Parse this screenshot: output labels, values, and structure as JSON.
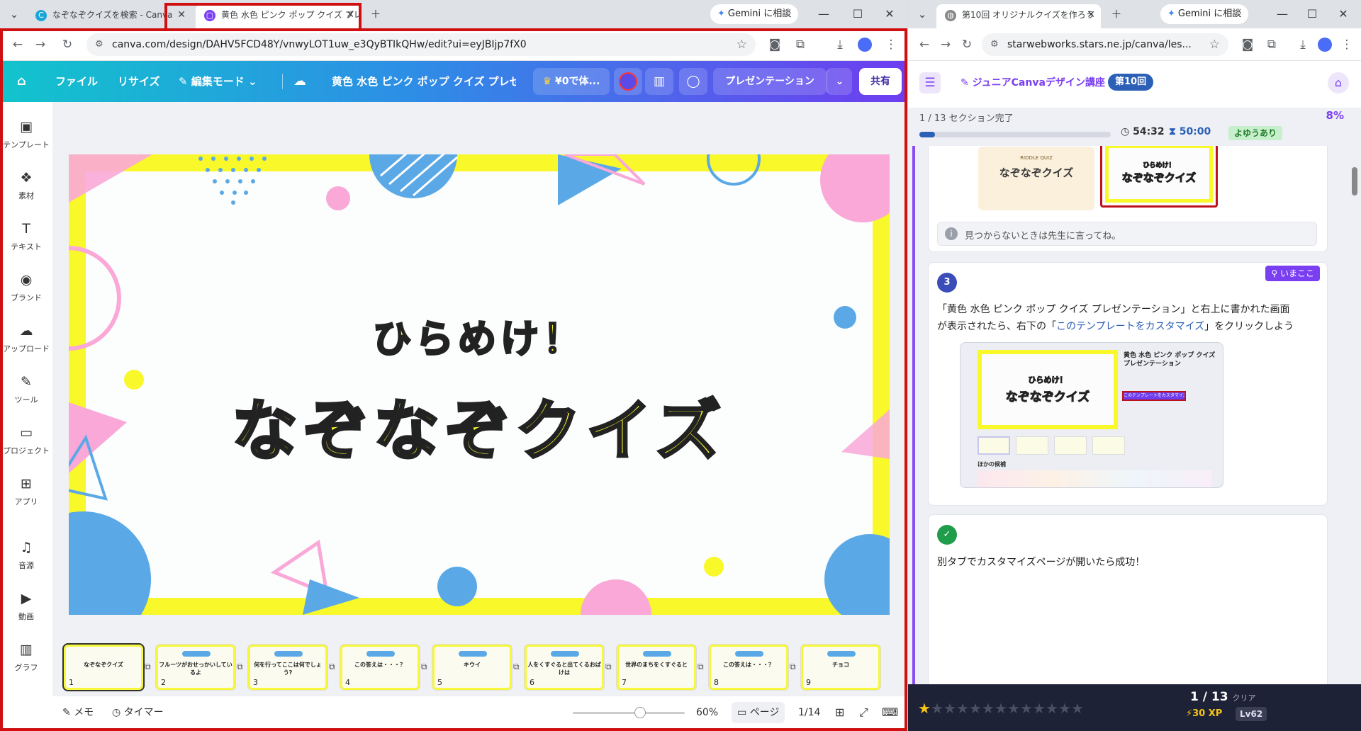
{
  "left_window": {
    "tabs": [
      {
        "title": "なぞなぞクイズを検索 - Canva",
        "active": false
      },
      {
        "title": "黄色 水色 ピンク ポップ クイズ プレ",
        "active": true
      }
    ],
    "gemini_label": "Gemini に相談",
    "url": "canva.com/design/DAHV5FCD48Y/vnwyLOT1uw_e3QyBTIkQHw/edit?ui=eyJBIjp7fX0"
  },
  "canva": {
    "toolbar": {
      "file": "ファイル",
      "resize": "リサイズ",
      "edit_mode": "編集モード",
      "title": "黄色 水色 ピンク ポップ クイズ プレゼ...",
      "trial": "¥0で体...",
      "present": "プレゼンテーション",
      "share": "共有"
    },
    "sidebar": [
      {
        "label": "テンプレート",
        "icon": "template-icon"
      },
      {
        "label": "素材",
        "icon": "elements-icon"
      },
      {
        "label": "テキスト",
        "icon": "text-icon"
      },
      {
        "label": "ブランド",
        "icon": "brand-icon"
      },
      {
        "label": "アップロード",
        "icon": "upload-icon"
      },
      {
        "label": "ツール",
        "icon": "tools-icon"
      },
      {
        "label": "プロジェクト",
        "icon": "folder-icon"
      },
      {
        "label": "アプリ",
        "icon": "apps-icon"
      },
      {
        "label": "音源",
        "icon": "music-icon"
      },
      {
        "label": "動画",
        "icon": "video-icon"
      },
      {
        "label": "グラフ",
        "icon": "chart-icon"
      }
    ],
    "slide": {
      "subtitle": "ひらめけ！",
      "title": "なぞなぞクイズ",
      "colors": {
        "yellow": "#f8f82b",
        "pink": "#f9a8d8",
        "blue": "#5aa9e6"
      }
    },
    "thumbnails": [
      {
        "num": "1",
        "text": "なぞなぞクイズ"
      },
      {
        "num": "2",
        "text": "フルーツがおせっかいしているよ"
      },
      {
        "num": "3",
        "text": "何を行ってここは何でしょう?"
      },
      {
        "num": "4",
        "text": "この答えは・・・？"
      },
      {
        "num": "5",
        "text": "キウイ"
      },
      {
        "num": "6",
        "text": "人をくすぐると出てくるおばけは"
      },
      {
        "num": "7",
        "text": "世界のまちをくすぐると"
      },
      {
        "num": "8",
        "text": "この答えは・・・？"
      },
      {
        "num": "9",
        "text": "チョコ"
      }
    ],
    "footer": {
      "notes": "メモ",
      "timer": "タイマー",
      "zoom": "60%",
      "zoom_fraction": 0.6,
      "pages": "ページ",
      "page_count": "1/14"
    }
  },
  "right_window": {
    "tab_title": "第10回 オリジナルクイズを作ろう",
    "gemini_label": "Gemini に相談",
    "url": "starwebworks.stars.ne.jp/canva/les...",
    "header": {
      "course": "ジュニアCanvaデザイン講座",
      "session": "第10回"
    },
    "progress": {
      "text": "1 / 13 セクション完了",
      "percent": "8%",
      "percent_value": 0.08,
      "time_used": "54:32",
      "time_limit": "50:00",
      "status": "よゆうあり"
    },
    "hint": "見つからないときは先生に言ってね。",
    "step": {
      "num": "3",
      "badge": "いまここ",
      "text1": "「黄色 水色 ピンク ポップ クイズ プレゼンテーション」と右上に書かれた画面",
      "text2_prefix": "が表示されたら、右下の「",
      "link": "このテンプレートをカスタマイズ",
      "text2_suffix": "」をクリックしよう"
    },
    "shot": {
      "template_title": "黄色 水色 ピンク ポップ クイズプレゼンテーション",
      "button": "このテンプレートをカスタマイズ",
      "other": "ほかの候補",
      "slide_sub": "ひらめけ！",
      "slide_title": "なぞなぞクイズ",
      "riddle_title": "なぞなぞクイズ",
      "riddle_small": "RIDDLE QUIZ"
    },
    "success": "別タブでカスタマイズページが開いたら成功！",
    "footer": {
      "clear": "1 / 13",
      "clear_label": "クリア",
      "xp": "30 XP",
      "level": "Lv62",
      "stars_filled": 1,
      "stars_total": 13
    }
  }
}
